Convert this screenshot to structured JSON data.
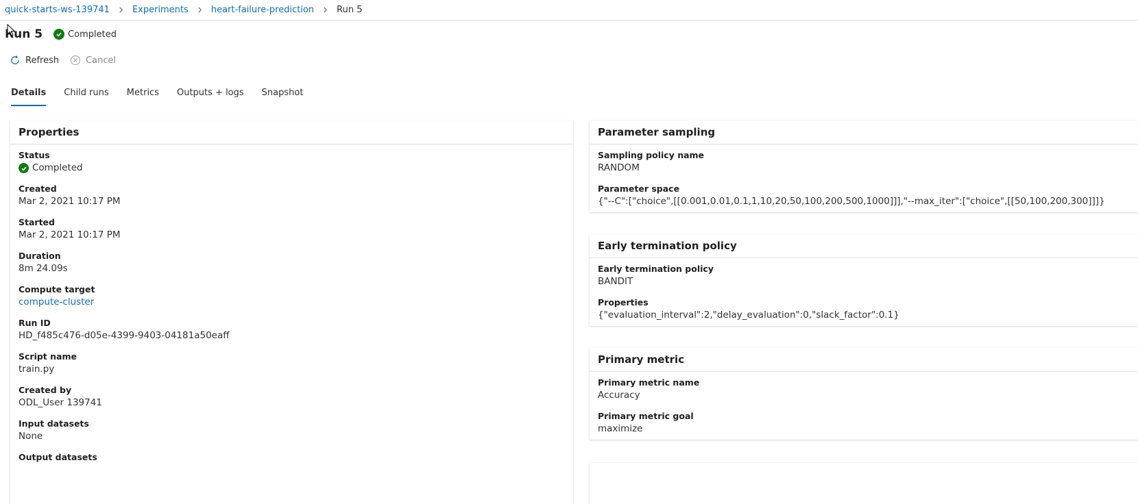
{
  "breadcrumb": {
    "workspace": "quick-starts-ws-139741",
    "experiments": "Experiments",
    "experiment": "heart-failure-prediction",
    "current": "Run 5"
  },
  "title": {
    "text": "Run 5",
    "status": "Completed"
  },
  "toolbar": {
    "refresh": "Refresh",
    "cancel": "Cancel"
  },
  "tabs": [
    "Details",
    "Child runs",
    "Metrics",
    "Outputs + logs",
    "Snapshot"
  ],
  "active_tab": "Details",
  "properties": {
    "header": "Properties",
    "status_label": "Status",
    "status_value": "Completed",
    "created_label": "Created",
    "created_value": "Mar 2, 2021 10:17 PM",
    "started_label": "Started",
    "started_value": "Mar 2, 2021 10:17 PM",
    "duration_label": "Duration",
    "duration_value": "8m 24.09s",
    "compute_label": "Compute target",
    "compute_value": "compute-cluster",
    "runid_label": "Run ID",
    "runid_value": "HD_f485c476-d05e-4399-9403-04181a50eaff",
    "script_label": "Script name",
    "script_value": "train.py",
    "createdby_label": "Created by",
    "createdby_value": "ODL_User 139741",
    "input_label": "Input datasets",
    "input_value": "None",
    "output_label": "Output datasets"
  },
  "sampling": {
    "header": "Parameter sampling",
    "policy_label": "Sampling policy name",
    "policy_value": "RANDOM",
    "space_label": "Parameter space",
    "space_value": "{\"--C\":[\"choice\",[[0.001,0.01,0.1,1,10,20,50,100,200,500,1000]]],\"--max_iter\":[\"choice\",[[50,100,200,300]]]}"
  },
  "termination": {
    "header": "Early termination policy",
    "policy_label": "Early termination policy",
    "policy_value": "BANDIT",
    "props_label": "Properties",
    "props_value": "{\"evaluation_interval\":2,\"delay_evaluation\":0,\"slack_factor\":0.1}"
  },
  "metric": {
    "header": "Primary metric",
    "name_label": "Primary metric name",
    "name_value": "Accuracy",
    "goal_label": "Primary metric goal",
    "goal_value": "maximize"
  },
  "colors": {
    "link": "#0f6cbd",
    "success": "#107c10",
    "text": "#323130",
    "divider": "#e1dfdd"
  },
  "icons": [
    "chevron-right-icon",
    "check-circle-icon",
    "refresh-icon",
    "cancel-icon",
    "mouse-cursor-icon"
  ]
}
